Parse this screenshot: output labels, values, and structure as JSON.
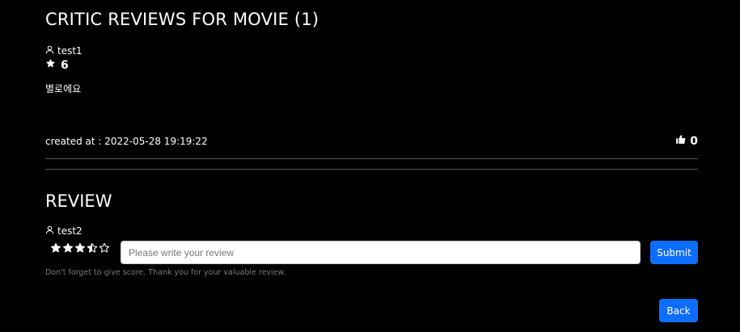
{
  "header": {
    "title": "CRITIC REVIEWS FOR MOVIE (1)"
  },
  "critic_review": {
    "username": "test1",
    "user_icon": "user-icon",
    "score_icon": "star-icon",
    "score": "6",
    "content": "별로에요",
    "created_at": "created at : 2022-05-28 19:19:22",
    "like_icon": "thumbs-up-icon",
    "likes": "0"
  },
  "review_form": {
    "title": "REVIEW",
    "username": "test2",
    "rating": 3.5,
    "rating_max": 5,
    "placeholder": "Please write your review",
    "submit_label": "Submit",
    "hint": "Don't forget to give score. Thank you for your valuable review."
  },
  "footer": {
    "back_label": "Back"
  }
}
